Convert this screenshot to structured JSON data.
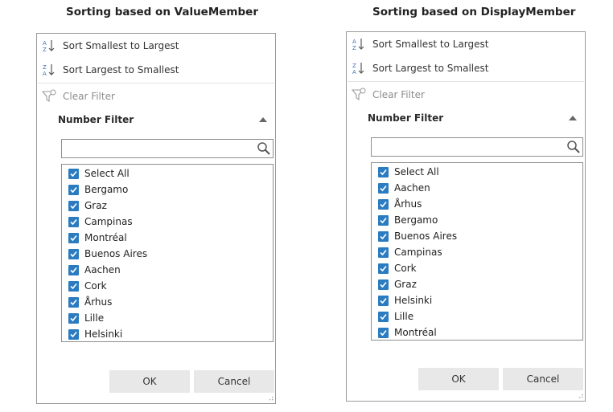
{
  "panels": [
    {
      "caption": "Sorting based on ValueMember",
      "menu": {
        "sort_asc": "Sort Smallest to Largest",
        "sort_desc": "Sort Largest to Smallest",
        "clear_filter": "Clear Filter"
      },
      "filter_header": "Number Filter",
      "search": {
        "value": "",
        "placeholder": ""
      },
      "items": [
        {
          "label": "Select All",
          "checked": true
        },
        {
          "label": "Bergamo",
          "checked": true
        },
        {
          "label": "Graz",
          "checked": true
        },
        {
          "label": "Campinas",
          "checked": true
        },
        {
          "label": "Montréal",
          "checked": true
        },
        {
          "label": "Buenos Aires",
          "checked": true
        },
        {
          "label": "Aachen",
          "checked": true
        },
        {
          "label": "Cork",
          "checked": true
        },
        {
          "label": "Århus",
          "checked": true
        },
        {
          "label": "Lille",
          "checked": true
        },
        {
          "label": "Helsinki",
          "checked": true
        }
      ],
      "buttons": {
        "ok": "OK",
        "cancel": "Cancel"
      }
    },
    {
      "caption": "Sorting based on DisplayMember",
      "menu": {
        "sort_asc": "Sort Smallest to Largest",
        "sort_desc": "Sort Largest to Smallest",
        "clear_filter": "Clear Filter"
      },
      "filter_header": "Number Filter",
      "search": {
        "value": "",
        "placeholder": ""
      },
      "items": [
        {
          "label": "Select All",
          "checked": true
        },
        {
          "label": "Aachen",
          "checked": true
        },
        {
          "label": "Århus",
          "checked": true
        },
        {
          "label": "Bergamo",
          "checked": true
        },
        {
          "label": "Buenos Aires",
          "checked": true
        },
        {
          "label": "Campinas",
          "checked": true
        },
        {
          "label": "Cork",
          "checked": true
        },
        {
          "label": "Graz",
          "checked": true
        },
        {
          "label": "Helsinki",
          "checked": true
        },
        {
          "label": "Lille",
          "checked": true
        },
        {
          "label": "Montréal",
          "checked": true
        }
      ],
      "buttons": {
        "ok": "OK",
        "cancel": "Cancel"
      }
    }
  ],
  "colors": {
    "checkbox": "#2b7bc0",
    "sort_icon_blue": "#3a6fb5",
    "border": "#9a9a9a",
    "button_bg": "#e8e8e8"
  }
}
